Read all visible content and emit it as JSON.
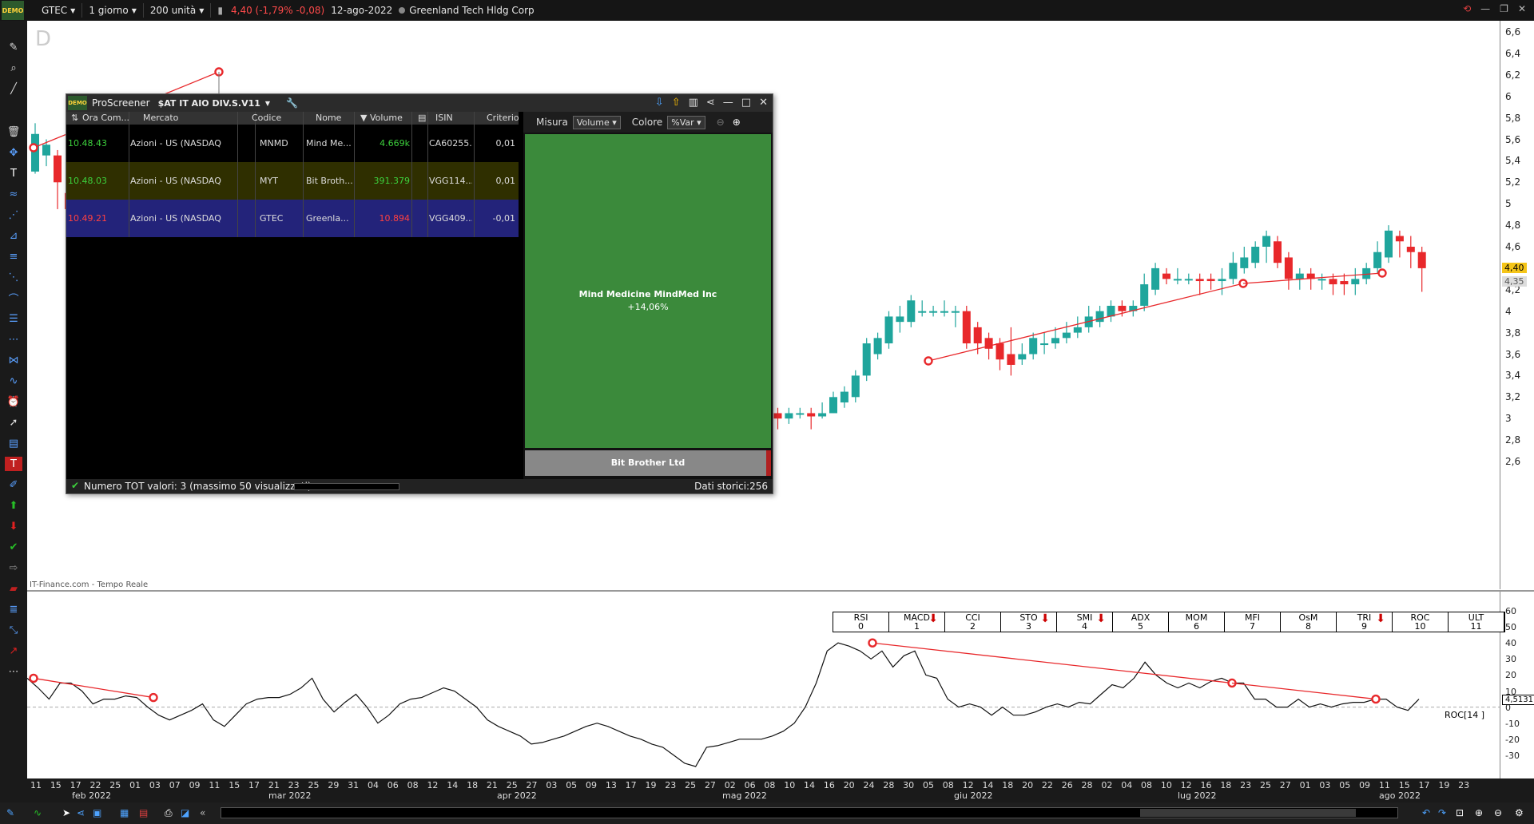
{
  "topbar": {
    "demo_badge": "DEMO",
    "symbol": "GTEC",
    "timeframe": "1 giorno",
    "units": "200 unità",
    "quote": "4,40 (-1,79% -0,08)",
    "date": "12-ago-2022",
    "company": "Greenland Tech Hldg Corp"
  },
  "chart": {
    "watermark": "D",
    "source": "IT-Finance.com - Tempo Reale",
    "price_labels": [
      "6,6",
      "6,4",
      "6,2",
      "6",
      "5,8",
      "5,6",
      "5,4",
      "5,2",
      "5",
      "4,8",
      "4,6",
      "4,4",
      "4,2",
      "4",
      "3,8",
      "3,6",
      "3,4",
      "3,2",
      "3",
      "2,8",
      "2,6"
    ],
    "price_min": 2.6,
    "price_max": 6.6,
    "last_price_tag": "4,40",
    "second_price_tag": "4,35",
    "up_color": "#1fa59c",
    "down_color": "#e8282b",
    "trendline_color": "#e8282b",
    "candles": [
      [
        5.3,
        5.65,
        5.75,
        5.28
      ],
      [
        5.45,
        5.55,
        5.6,
        5.35
      ],
      [
        5.45,
        5.2,
        5.5,
        4.95
      ],
      [
        5.1,
        4.95,
        5.15,
        4.85
      ]
    ],
    "candles_right": [
      [
        3.1,
        2.85,
        3.2,
        2.8
      ],
      [
        3.05,
        2.78,
        3.1,
        2.6
      ],
      [
        2.9,
        3.05,
        3.1,
        2.85
      ],
      [
        3.05,
        3.0,
        3.15,
        2.95
      ],
      [
        3.0,
        3.05,
        3.1,
        2.95
      ],
      [
        3.05,
        3.0,
        3.1,
        2.9
      ],
      [
        3.0,
        3.05,
        3.1,
        2.95
      ],
      [
        3.05,
        3.05,
        3.1,
        3.0
      ],
      [
        3.05,
        3.02,
        3.1,
        2.9
      ],
      [
        3.02,
        3.05,
        3.15,
        3.0
      ],
      [
        3.05,
        3.2,
        3.25,
        3.05
      ],
      [
        3.15,
        3.25,
        3.3,
        3.1
      ],
      [
        3.2,
        3.4,
        3.45,
        3.15
      ],
      [
        3.4,
        3.7,
        3.75,
        3.35
      ],
      [
        3.6,
        3.75,
        3.8,
        3.55
      ],
      [
        3.7,
        3.95,
        4.0,
        3.65
      ],
      [
        3.9,
        3.95,
        4.05,
        3.8
      ],
      [
        3.9,
        4.1,
        4.15,
        3.85
      ],
      [
        4.0,
        4.0,
        4.1,
        3.95
      ],
      [
        4.0,
        4.0,
        4.05,
        3.95
      ],
      [
        4.0,
        4.0,
        4.1,
        3.95
      ],
      [
        4.0,
        4.0,
        4.05,
        3.85
      ],
      [
        4.0,
        3.7,
        4.05,
        3.65
      ],
      [
        3.85,
        3.7,
        3.9,
        3.6
      ],
      [
        3.75,
        3.65,
        3.8,
        3.55
      ],
      [
        3.7,
        3.55,
        3.75,
        3.45
      ],
      [
        3.6,
        3.5,
        3.85,
        3.4
      ],
      [
        3.55,
        3.6,
        3.7,
        3.5
      ],
      [
        3.6,
        3.75,
        3.8,
        3.55
      ],
      [
        3.7,
        3.7,
        3.8,
        3.6
      ],
      [
        3.7,
        3.75,
        3.85,
        3.65
      ],
      [
        3.75,
        3.8,
        3.9,
        3.7
      ],
      [
        3.8,
        3.85,
        3.95,
        3.75
      ],
      [
        3.85,
        3.95,
        4.05,
        3.8
      ],
      [
        3.9,
        4.0,
        4.05,
        3.85
      ],
      [
        3.95,
        4.05,
        4.1,
        3.9
      ],
      [
        4.05,
        4.0,
        4.1,
        3.95
      ],
      [
        4.0,
        4.05,
        4.1,
        3.95
      ],
      [
        4.05,
        4.25,
        4.35,
        4.0
      ],
      [
        4.2,
        4.4,
        4.45,
        4.15
      ],
      [
        4.35,
        4.3,
        4.4,
        4.25
      ],
      [
        4.3,
        4.3,
        4.4,
        4.25
      ],
      [
        4.3,
        4.3,
        4.35,
        4.25
      ],
      [
        4.3,
        4.28,
        4.35,
        4.15
      ],
      [
        4.3,
        4.28,
        4.35,
        4.2
      ],
      [
        4.28,
        4.3,
        4.4,
        4.15
      ],
      [
        4.3,
        4.45,
        4.55,
        4.25
      ],
      [
        4.4,
        4.5,
        4.6,
        4.35
      ],
      [
        4.45,
        4.6,
        4.65,
        4.4
      ],
      [
        4.6,
        4.7,
        4.75,
        4.45
      ],
      [
        4.65,
        4.45,
        4.7,
        4.4
      ],
      [
        4.5,
        4.3,
        4.55,
        4.2
      ],
      [
        4.3,
        4.35,
        4.4,
        4.2
      ],
      [
        4.35,
        4.3,
        4.4,
        4.2
      ],
      [
        4.3,
        4.3,
        4.35,
        4.2
      ],
      [
        4.3,
        4.25,
        4.35,
        4.15
      ],
      [
        4.28,
        4.25,
        4.35,
        4.15
      ],
      [
        4.25,
        4.3,
        4.4,
        4.15
      ],
      [
        4.3,
        4.4,
        4.45,
        4.25
      ],
      [
        4.4,
        4.55,
        4.65,
        4.35
      ],
      [
        4.5,
        4.75,
        4.8,
        4.45
      ],
      [
        4.7,
        4.65,
        4.75,
        4.5
      ],
      [
        4.6,
        4.55,
        4.7,
        4.4
      ],
      [
        4.55,
        4.4,
        4.6,
        4.18
      ]
    ]
  },
  "proscreener": {
    "demo_badge": "DEMO",
    "title": "ProScreener",
    "screener": "$AT IT AIO DIV.S.V11",
    "columns": [
      "Ora Com...",
      "Mercato",
      "Codice",
      "Nome",
      "Volume",
      "",
      "ISIN",
      "Criterio"
    ],
    "rows": [
      {
        "time": "10.48.43",
        "market": "Azioni - US (NASDAQ",
        "code": "MNMD",
        "name": "Mind Me...",
        "volume": "4.669k",
        "isin": "CA60255...",
        "crit": "0,01",
        "time_color": "#3cd03c",
        "vol_color": "#3cd03c",
        "bg": "#000000"
      },
      {
        "time": "10.48.03",
        "market": "Azioni - US (NASDAQ",
        "code": "MYT",
        "name": "Bit Broth...",
        "volume": "391.379",
        "isin": "VGG114...",
        "crit": "0,01",
        "time_color": "#3cd03c",
        "vol_color": "#3cd03c",
        "bg": "#2f2f00"
      },
      {
        "time": "10.49.21",
        "market": "Azioni - US (NASDAQ",
        "code": "GTEC",
        "name": "Greenla...",
        "volume": "10.894",
        "isin": "VGG409...",
        "crit": "-0,01",
        "time_color": "#ff4040",
        "vol_color": "#ff4040",
        "bg": "#23237a"
      }
    ],
    "misura_label": "Misura",
    "misura_value": "Volume",
    "colore_label": "Colore",
    "colore_value": "%Var",
    "tile1_name": "Mind Medicine MindMed Inc",
    "tile1_pct": "+14,06%",
    "tile2_name": "Bit Brother Ltd",
    "status_count": "Numero TOT valori: 3 (massimo 50 visualizzati)",
    "status_hist": "Dati storici:256"
  },
  "indicator": {
    "label": "ROC[14 ]",
    "value_tag": "4,5131",
    "axis_labels": [
      "60",
      "50",
      "40",
      "30",
      "20",
      "10",
      "0",
      "-10",
      "-20",
      "-30"
    ],
    "tabs": [
      {
        "name": "RSI",
        "num": "0",
        "arrow": false
      },
      {
        "name": "MACD",
        "num": "1",
        "arrow": true
      },
      {
        "name": "CCI",
        "num": "2",
        "arrow": false
      },
      {
        "name": "STO",
        "num": "3",
        "arrow": true
      },
      {
        "name": "SMI",
        "num": "4",
        "arrow": true
      },
      {
        "name": "ADX",
        "num": "5",
        "arrow": false
      },
      {
        "name": "MOM",
        "num": "6",
        "arrow": false
      },
      {
        "name": "MFI",
        "num": "7",
        "arrow": false
      },
      {
        "name": "OsM",
        "num": "8",
        "arrow": false
      },
      {
        "name": "TRI",
        "num": "9",
        "arrow": true
      },
      {
        "name": "ROC",
        "num": "10",
        "arrow": false
      },
      {
        "name": "ULT",
        "num": "11",
        "arrow": false
      }
    ],
    "roc_values": [
      18,
      12,
      5,
      15,
      15,
      10,
      2,
      5,
      5,
      7,
      6,
      0,
      -5,
      -8,
      -5,
      -2,
      2,
      -8,
      -12,
      -5,
      2,
      5,
      6,
      6,
      8,
      12,
      18,
      5,
      -3,
      3,
      8,
      0,
      -10,
      -5,
      2,
      5,
      6,
      9,
      12,
      10,
      5,
      0,
      -8,
      -12,
      -15,
      -18,
      -23,
      -22,
      -20,
      -18,
      -15,
      -12,
      -10,
      -12,
      -15,
      -18,
      -20,
      -23,
      -25,
      -30,
      -35,
      -37,
      -25,
      -24,
      -22,
      -20,
      -20,
      -20,
      -18,
      -15,
      -10,
      0,
      15,
      35,
      40,
      38,
      35,
      30,
      35,
      25,
      32,
      35,
      20,
      18,
      5,
      0,
      2,
      0,
      -5,
      0,
      -5,
      -5,
      -3,
      0,
      2,
      0,
      3,
      2,
      8,
      14,
      12,
      18,
      28,
      20,
      15,
      12,
      15,
      12,
      16,
      18,
      15,
      15,
      5,
      5,
      0,
      0,
      5,
      0,
      2,
      0,
      2,
      3,
      3,
      5,
      5,
      0,
      -2,
      5
    ],
    "date_ticks": [
      "11",
      "15",
      "17",
      "22",
      "25",
      "01",
      "03",
      "07",
      "09",
      "11",
      "15",
      "17",
      "21",
      "23",
      "25",
      "29",
      "31",
      "04",
      "06",
      "08",
      "12",
      "14",
      "18",
      "21",
      "25",
      "27",
      "03",
      "05",
      "09",
      "13",
      "17",
      "19",
      "23",
      "25",
      "27",
      "02",
      "06",
      "08",
      "10",
      "14",
      "16",
      "20",
      "24",
      "28",
      "30",
      "05",
      "08",
      "12",
      "14",
      "18",
      "20",
      "22",
      "26",
      "28",
      "02",
      "04",
      "08",
      "10",
      "12",
      "16",
      "18",
      "23",
      "25",
      "27",
      "01",
      "03",
      "05",
      "09",
      "11",
      "15",
      "17",
      "19",
      "23"
    ],
    "months": [
      {
        "label": "feb 2022"
      },
      {
        "label": "mar 2022"
      },
      {
        "label": "apr 2022"
      },
      {
        "label": "mag 2022"
      },
      {
        "label": "giu 2022"
      },
      {
        "label": "lug 2022"
      },
      {
        "label": "ago 2022"
      }
    ]
  },
  "colors": {
    "ps_row_green": "#3cd03c",
    "ps_row_red": "#ff4040",
    "tile_green": "#3b8a3b"
  }
}
